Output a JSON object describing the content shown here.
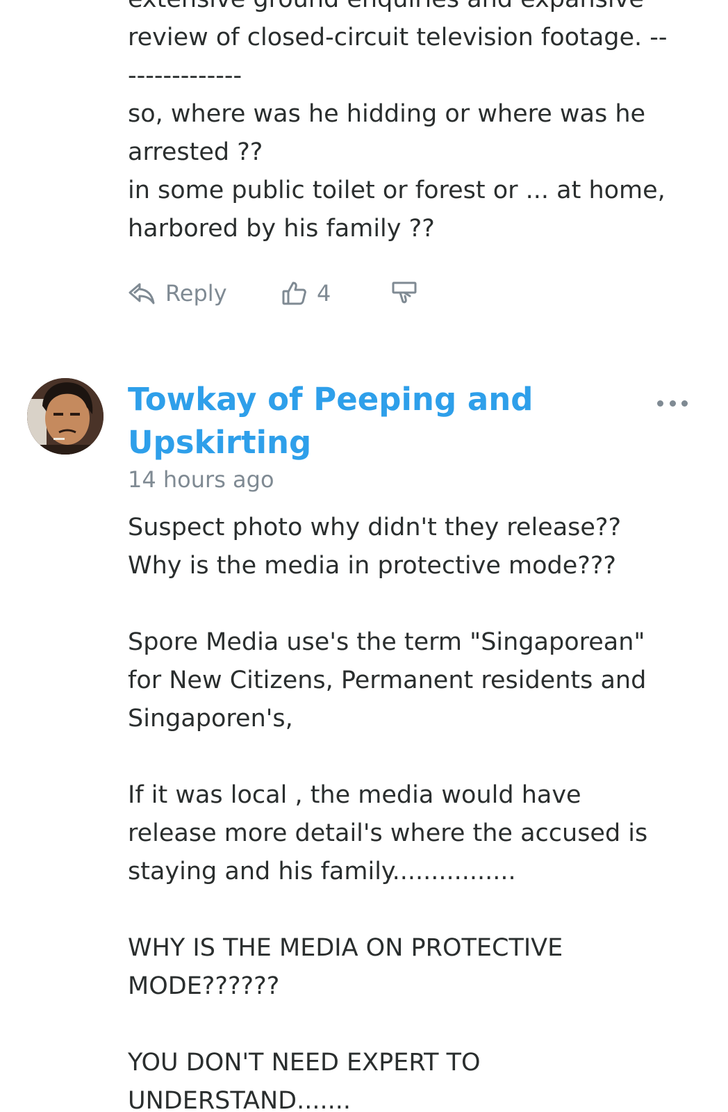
{
  "previous_comment": {
    "text": [
      "extensive ground enquiries and expansive",
      "review of closed-circuit television footage. --",
      "-------------",
      "so, where was he hidding or where was he",
      "arrested ??",
      "in some public toilet or forest or ... at home,",
      "harbored by his family ??"
    ],
    "actions": {
      "reply_label": "Reply",
      "upvote_count": "4",
      "reply_icon": "reply-arrow-icon",
      "upvote_icon": "thumbs-up-icon",
      "downvote_icon": "thumbs-down-icon"
    }
  },
  "comment": {
    "author": "Towkay of Peeping and Upskirting",
    "timestamp": "14 hours ago",
    "avatar_icon": "user-avatar",
    "menu_icon": "more-options-icon",
    "paragraphs": [
      "Suspect photo why didn't they release??\nWhy is the media in protective mode???",
      "Spore Media use's the term \"Singaporean\"\nfor New Citizens, Permanent residents and\nSingaporen's,",
      "If it was local , the media would have\nrelease more detail's where the accused is\nstaying and his family................",
      "WHY IS THE MEDIA ON PROTECTIVE\nMODE??????",
      "YOU DON'T NEED EXPERT TO\nUNDERSTAND......."
    ]
  },
  "colors": {
    "author_link": "#2e9fea",
    "body_text": "#2a2e2e",
    "muted": "#7f8a93",
    "background": "#ffffff"
  }
}
